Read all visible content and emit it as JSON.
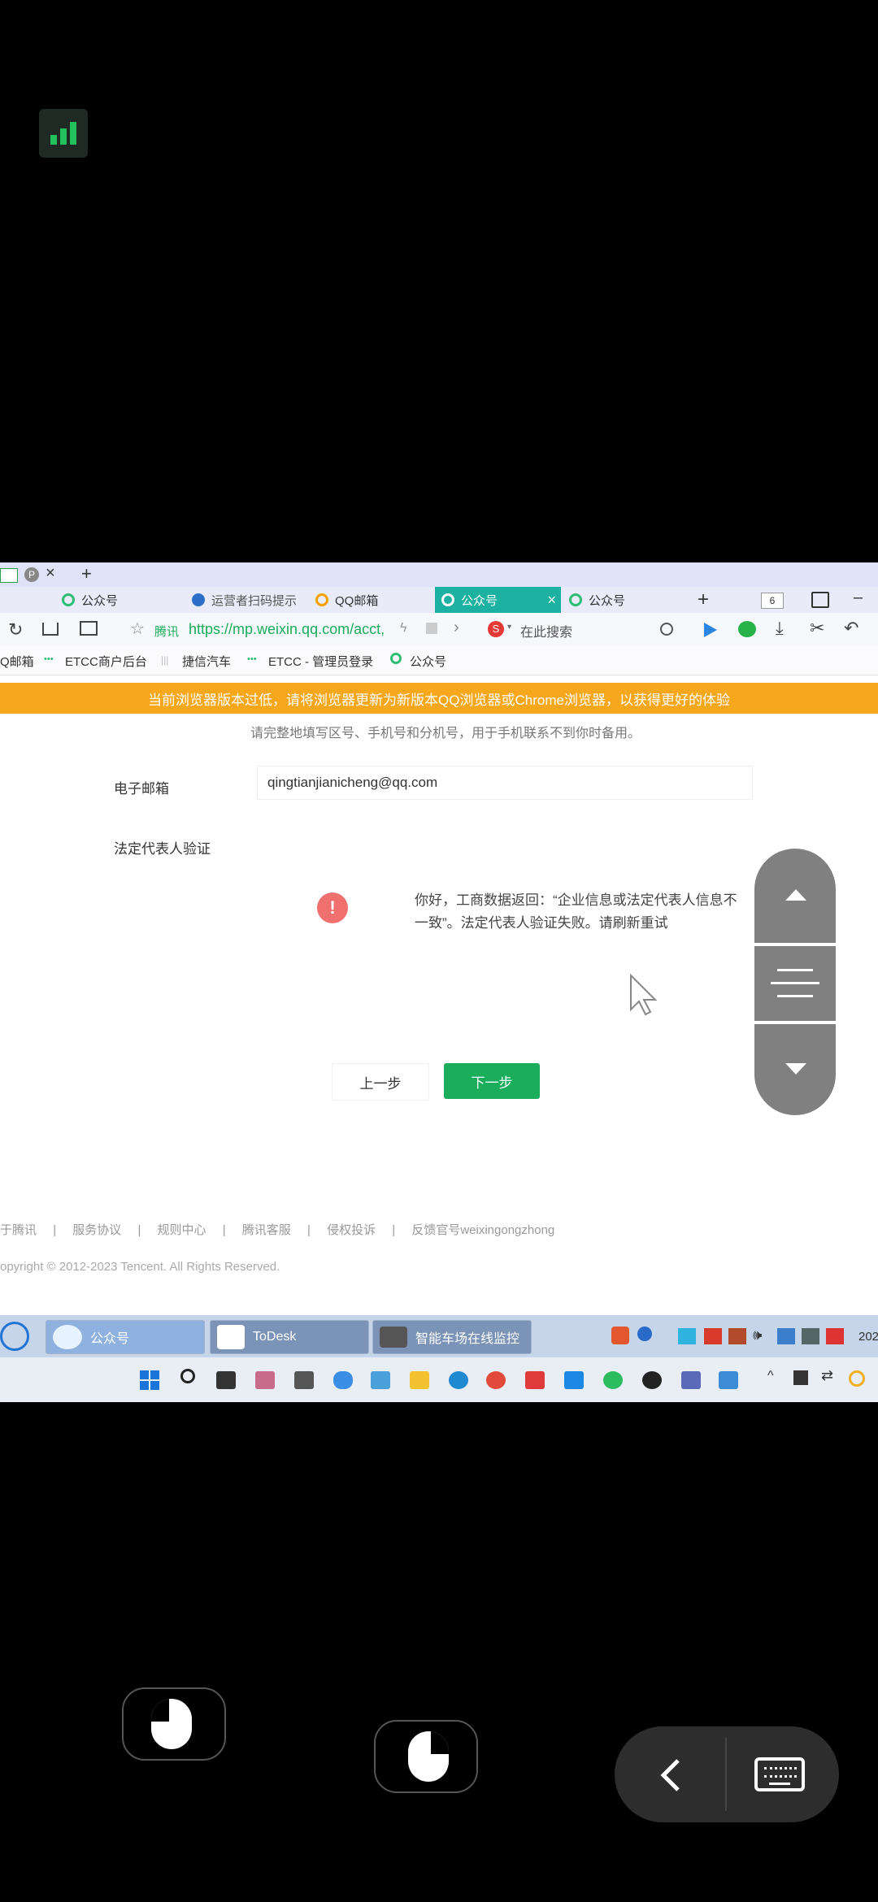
{
  "browser": {
    "tabs": [
      {
        "label": "公众号",
        "icon_color": "#2fbd75"
      },
      {
        "label": "运营者扫码提示",
        "icon_color": "#2c6fc9"
      },
      {
        "label": "QQ邮箱",
        "icon_color": "#f2a200"
      },
      {
        "label": "公众号",
        "icon_color": "#ffffff"
      },
      {
        "label": "公众号",
        "icon_color": "#2fbd75"
      }
    ],
    "tab_count": "6",
    "address_prefix": "腾讯",
    "url": "https://mp.weixin.qq.com/acct,",
    "search_placeholder": "在此搜索",
    "bookmarks": [
      "Q邮箱",
      "ETCC商户后台",
      "捷信汽车",
      "ETCC - 管理员登录",
      "公众号"
    ],
    "banner_text": "当前浏览器版本过低，请将浏览器更新为新版本QQ浏览器或Chrome浏览器，以获得更好的体验"
  },
  "page": {
    "hint_text": "请完整地填写区号、手机号和分机号，用于手机联系不到你时备用。",
    "email_label": "电子邮箱",
    "email_value": "qingtianjianicheng@qq.com",
    "legal_label": "法定代表人验证",
    "error_icon": "!",
    "error_message_line1": "你好，工商数据返回：“企业信息或法定代表人信息不",
    "error_message_line2": "一致”。法定代表人验证失败。请刷新重试",
    "prev_button": "上一步",
    "next_button": "下一步",
    "footer_links": [
      "于腾讯",
      "服务协议",
      "规则中心",
      "腾讯客服",
      "侵权投诉",
      "反馈官号weixingongzhong"
    ],
    "copyright": "opyright © 2012-2023 Tencent. All Rights Reserved."
  },
  "taskbar": {
    "apps": [
      "公众号",
      "ToDesk",
      "智能车场在线监控"
    ],
    "clock_partial": "202"
  },
  "colors": {
    "banner": "#f7a71b",
    "next_button": "#1aad5b",
    "active_tab": "#1db1a1",
    "error_icon": "#f07070"
  }
}
